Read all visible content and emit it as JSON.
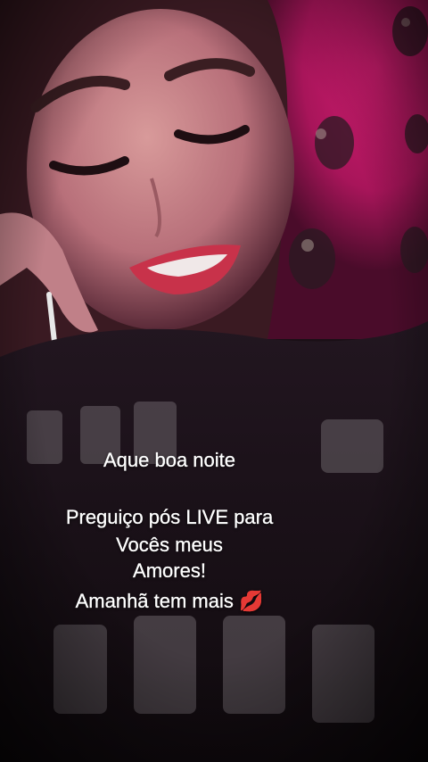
{
  "story": {
    "caption_lines": [
      "Aque boa noite",
      "Preguiço pós LIVE para",
      "Vocês meus",
      "Amores!",
      "Amanhã tem mais 💋"
    ]
  },
  "colors": {
    "background_pink": "#c2185b",
    "shirt_dark": "#1a1216",
    "text": "#ffffff"
  }
}
